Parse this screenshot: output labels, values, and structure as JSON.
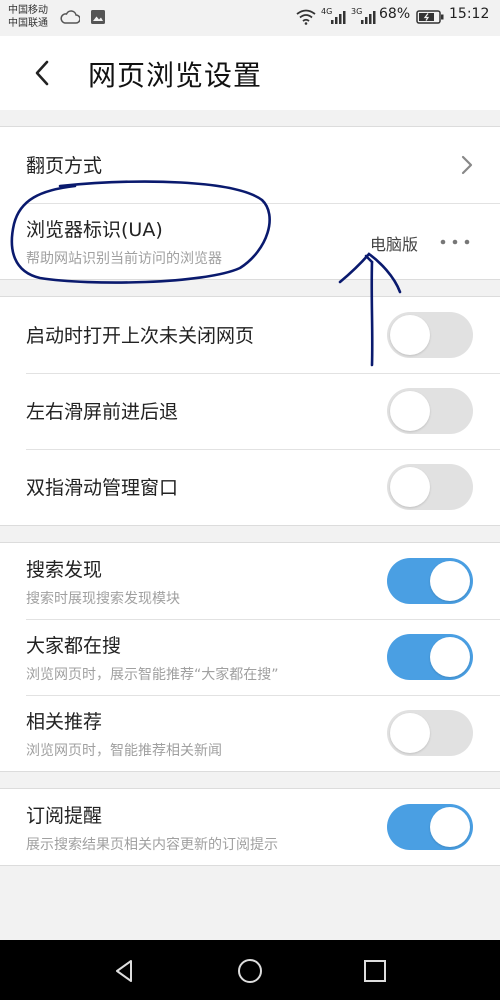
{
  "status_bar": {
    "carrier_1": "中国移动",
    "carrier_2": "中国联通",
    "net_1": "4G",
    "net_2": "3G",
    "battery": "68%",
    "time": "15:12"
  },
  "header": {
    "title": "网页浏览设置",
    "back_icon": "chevron-left-icon"
  },
  "sections": [
    {
      "rows": [
        {
          "title": "翻页方式",
          "type": "link"
        },
        {
          "title": "浏览器标识(UA)",
          "subtitle": "帮助网站识别当前访问的浏览器",
          "value": "电脑版",
          "type": "menu"
        }
      ]
    },
    {
      "rows": [
        {
          "title": "启动时打开上次未关闭网页",
          "toggle": "off"
        },
        {
          "title": "左右滑屏前进后退",
          "toggle": "off"
        },
        {
          "title": "双指滑动管理窗口",
          "toggle": "off"
        }
      ]
    },
    {
      "rows": [
        {
          "title": "搜索发现",
          "subtitle": "搜索时展现搜索发现模块",
          "toggle": "on"
        },
        {
          "title": "大家都在搜",
          "subtitle": "浏览网页时，展示智能推荐“大家都在搜”",
          "toggle": "on"
        },
        {
          "title": "相关推荐",
          "subtitle": "浏览网页时，智能推荐相关新闻",
          "toggle": "off"
        }
      ]
    },
    {
      "rows": [
        {
          "title": "订阅提醒",
          "subtitle": "展示搜索结果页相关内容更新的订阅提示",
          "toggle": "on"
        }
      ]
    }
  ],
  "colors": {
    "toggle_on": "#4a9fe3",
    "toggle_off": "#e1e1e1",
    "annotation_ink": "#0a1a6e"
  },
  "nav": [
    "back-triangle-icon",
    "home-circle-icon",
    "recents-square-icon"
  ]
}
